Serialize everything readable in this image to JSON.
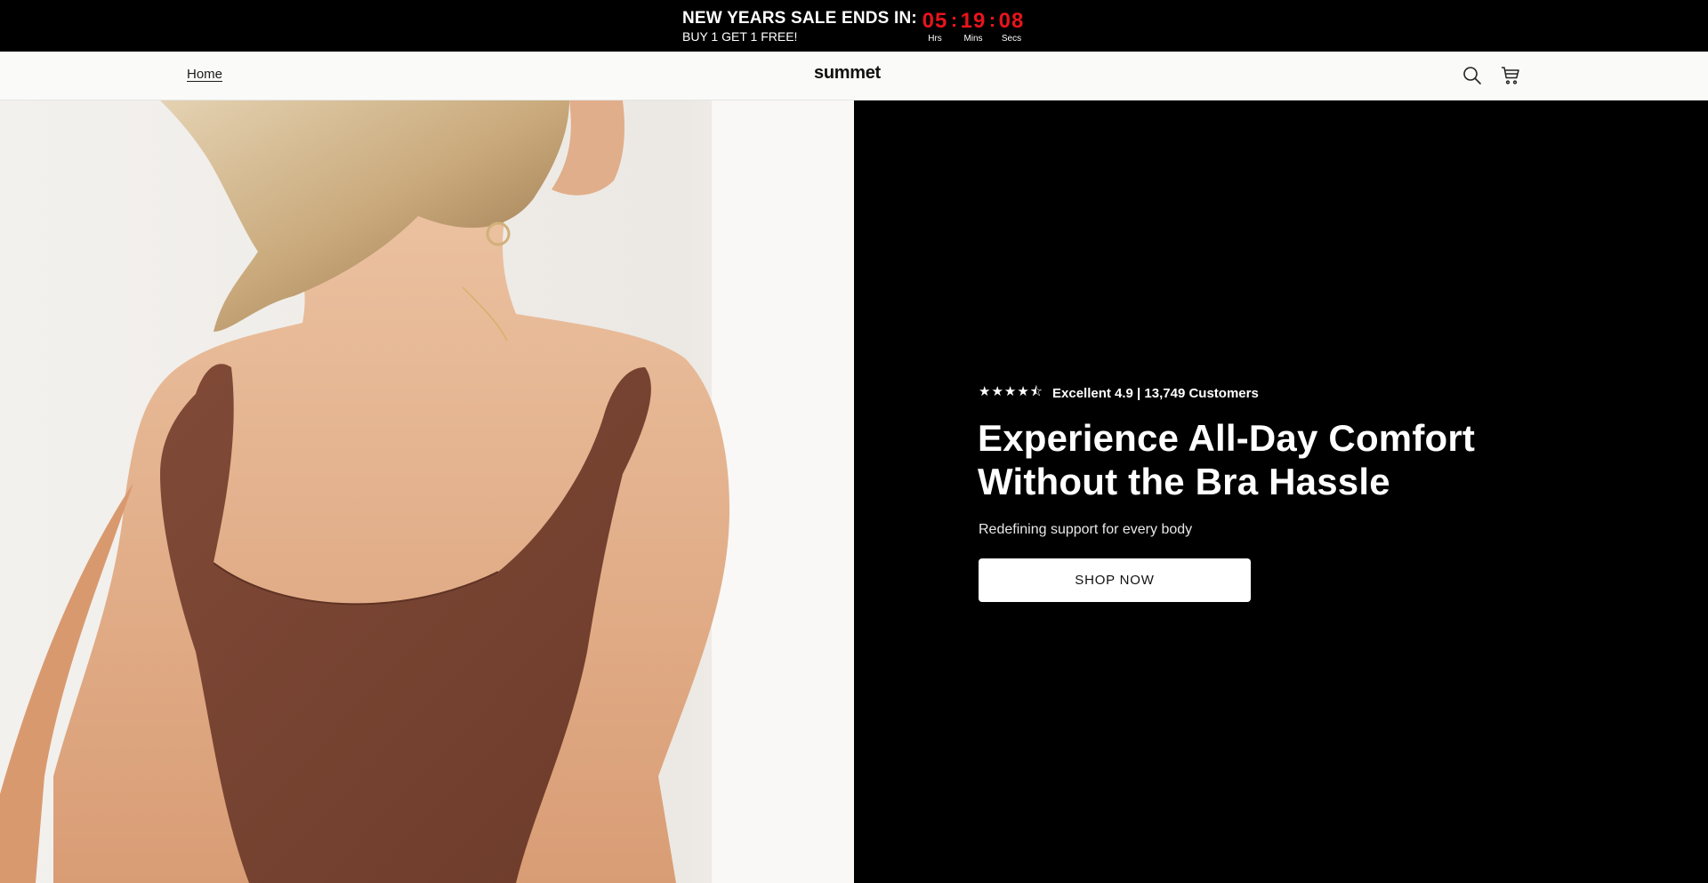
{
  "announcement": {
    "headline": "NEW YEARS SALE ENDS IN:",
    "subline": "BUY 1 GET 1 FREE!",
    "timer": {
      "hours": "05",
      "minutes": "19",
      "seconds": "08",
      "hours_label": "Hrs",
      "minutes_label": "Mins",
      "seconds_label": "Secs",
      "separator": ":",
      "digit_color": "#e8141b"
    }
  },
  "header": {
    "nav_home": "Home",
    "logo": "summet",
    "search_icon": "search-icon",
    "cart_icon": "cart-icon"
  },
  "hero": {
    "stars": "★★★★⯪",
    "rating_value": 4.5,
    "rating_text": "Excellent 4.9 | 13,749 Customers",
    "title": "Experience All-Day Comfort Without the Bra Hassle",
    "subtitle": "Redefining support for every body",
    "cta_label": "SHOP NOW"
  },
  "colors": {
    "announcement_bg": "#000000",
    "header_bg": "#fafaf8",
    "hero_panel_bg": "#000000",
    "button_bg": "#ffffff",
    "tank_top": "#7a4533"
  }
}
